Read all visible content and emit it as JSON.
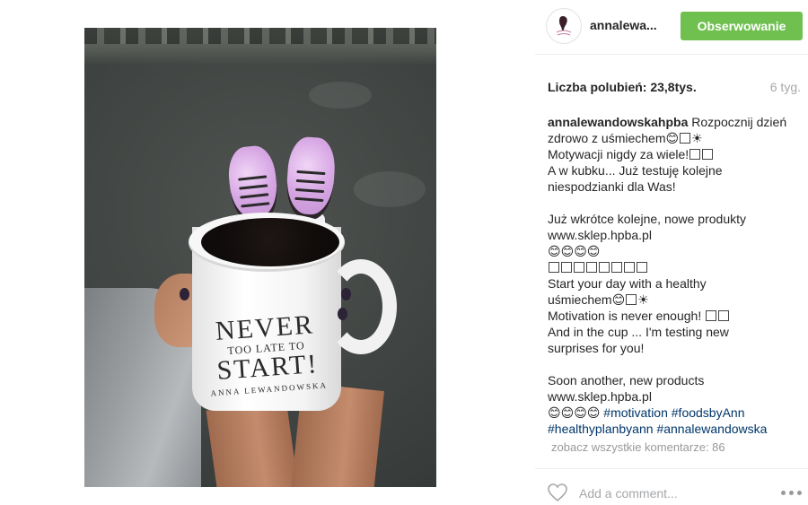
{
  "header": {
    "username": "annalewa...",
    "follow_button": "Obserwowanie",
    "avatar_icon": "avatar-logo"
  },
  "stats": {
    "likes_label": "Liczba polubień:",
    "likes_value": "23,8tys.",
    "time_ago": "6 tyg."
  },
  "caption": {
    "author": "annalewandowskahpba",
    "line1": " Rozpocznij dzień",
    "line2": "zdrowo z uśmiechem",
    "line3": "Motywacji nigdy za wiele!",
    "line4": "A w kubku... Już testuję kolejne",
    "line5": "niespodzianki dla Was!",
    "line6": "Już wkrótce kolejne, nowe produkty",
    "line7": "www.sklep.hpba.pl",
    "line8": "😊😊😊😊",
    "line10": "Start your day with a healthy",
    "line11": "uśmiechem",
    "line12": "Motivation is never enough!",
    "line13": "And in the cup ... I'm testing new",
    "line14": "surprises for you!",
    "line15": "Soon another, new products",
    "line16": "www.sklep.hpba.pl",
    "line17_emoji": "😊😊😊😊 ",
    "tags": [
      "#motivation",
      "#foodsbyAnn",
      "#healthyplanbyann",
      "#annalewandowska"
    ]
  },
  "comments": {
    "view_all": "zobacz wszystkie komentarze: 86",
    "placeholder": "Add a comment..."
  },
  "mug": {
    "line_big1": "NEVER",
    "line_small": "TOO LATE TO",
    "line_big2": "START!",
    "signature": "ANNA LEWANDOWSKA"
  },
  "icons": {
    "like": "heart-icon",
    "more": "more-options-icon"
  },
  "colors": {
    "follow_button": "#70c050",
    "hashtag": "#003569",
    "muted": "#a5a7aa"
  }
}
